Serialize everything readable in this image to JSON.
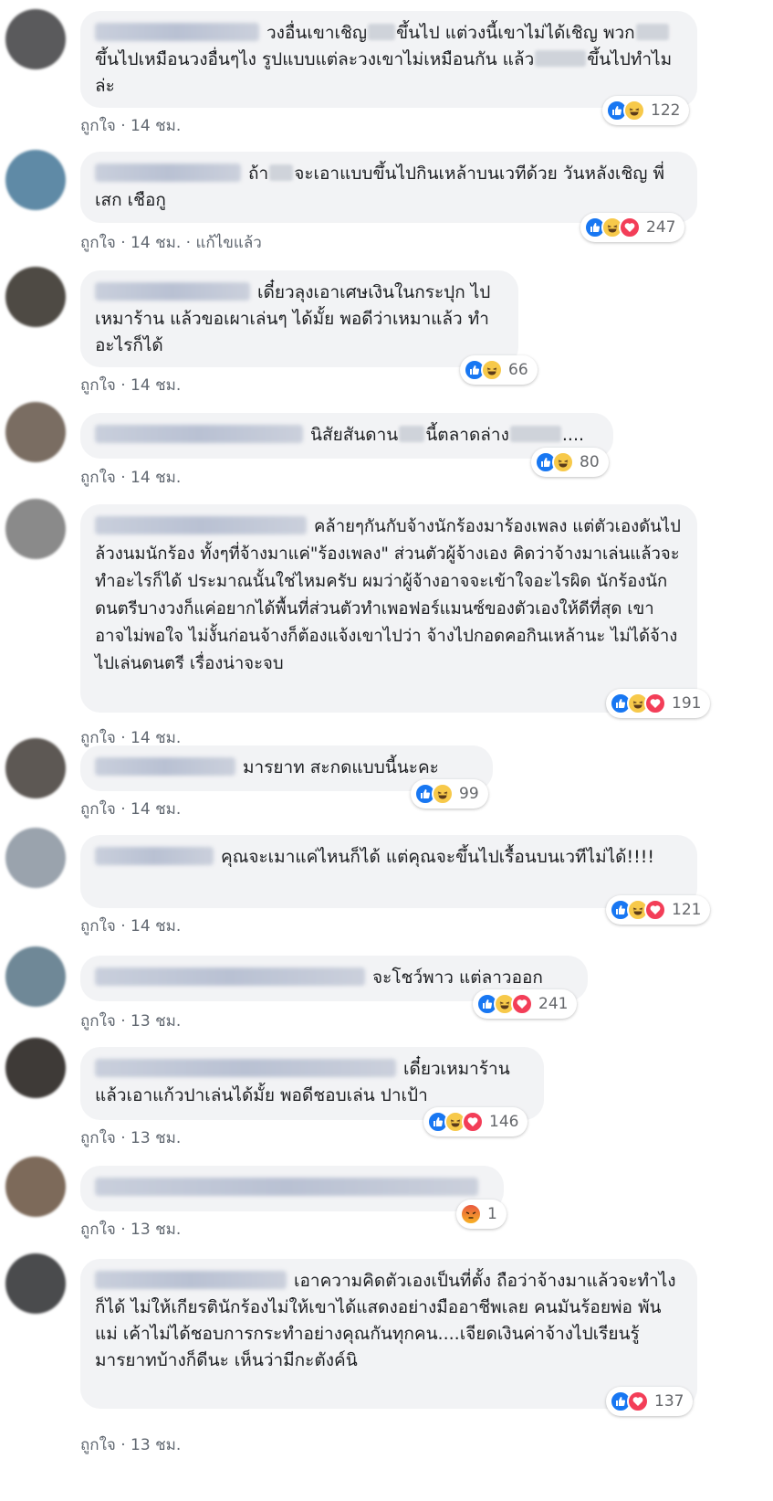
{
  "comments": [
    {
      "text": "วงอื่นเขาเชิญ▒ขึ้นไป แต่วงนี้เขาไม่ได้เชิญ พวก▒ขึ้นไปเหมือนวงอื่นๆไง รูปแบบแต่ละวงเขาไม่เหมือนกัน แล้ว▒ขึ้นไปทำไมล่ะ",
      "meta": "ถูกใจ · 14 ชม.",
      "reactions": [
        "like",
        "haha"
      ],
      "count": "122",
      "avatar": "#5a5a5c"
    },
    {
      "text": "ถ้า▒จะเอาแบบขึ้นไปกินเหล้าบนเวทีด้วย วันหลังเชิญ พี่เสก เชือกู",
      "meta": "ถูกใจ · 14 ชม. · แก้ไขแล้ว",
      "reactions": [
        "like",
        "haha",
        "love"
      ],
      "count": "247",
      "avatar": "#5f8aa6"
    },
    {
      "text": "เดี๋ยวลุงเอาเศษเงินในกระปุก ไปเหมาร้าน แล้วขอเผาเล่นๆ ได้มั้ย พอดีว่าเหมาแล้ว ทำอะไรก็ได้",
      "meta": "ถูกใจ · 14 ชม.",
      "reactions": [
        "like",
        "haha"
      ],
      "count": "66",
      "avatar": "#4e4a44"
    },
    {
      "text": "นิสัยสันดาน▒นี้ตลาดล่าง▒....",
      "meta": "ถูกใจ · 14 ชม.",
      "reactions": [
        "like",
        "haha"
      ],
      "count": "80",
      "avatar": "#7a6d62"
    },
    {
      "text": "คล้ายๆกันกับจ้างนักร้องมาร้องเพลง แต่ตัวเองดันไปล้วงนมนักร้อง ทั้งๆที่จ้างมาแค่\"ร้องเพลง\" ส่วนตัวผู้จ้างเอง คิดว่าจ้างมาเล่นแล้วจะทำอะไรก็ได้ ประมาณนั้นใช่ไหมครับ ผมว่าผู้จ้างอาจจะเข้าใจอะไรผิด นักร้องนักดนตรีบางวงก็แค่อยากได้พื้นที่ส่วนตัวทำเพอฟอร์แมนซ์ของตัวเองให้ดีที่สุด เขาอาจไม่พอใจ ไม่งั้นก่อนจ้างก็ต้องแจ้งเขาไปว่า จ้างไปกอดคอกินเหล้านะ ไม่ได้จ้างไปเล่นดนตรี เรื่องน่าจะจบ",
      "meta": "ถูกใจ · 14 ชม.",
      "reactions": [
        "like",
        "haha",
        "love"
      ],
      "count": "191",
      "avatar": "#8a8a8a"
    },
    {
      "text": "มารยาท สะกดแบบนี้นะคะ",
      "meta": "ถูกใจ · 14 ชม.",
      "reactions": [
        "like",
        "haha"
      ],
      "count": "99",
      "avatar": "#5d5854"
    },
    {
      "text": "คุณจะเมาแค่ไหนก็ได้ แต่คุณจะขึ้นไปเรื้อนบนเวทีไม่ได้!!!!",
      "meta": "ถูกใจ · 14 ชม.",
      "reactions": [
        "like",
        "haha",
        "love"
      ],
      "count": "121",
      "avatar": "#9aa3ad"
    },
    {
      "text": "จะโชว์พาว แต่ลาวออก",
      "meta": "ถูกใจ · 13 ชม.",
      "reactions": [
        "like",
        "haha",
        "love"
      ],
      "count": "241",
      "avatar": "#6f8897"
    },
    {
      "text": "เดี๋ยวเหมาร้าน แล้วเอาแก้วปาเล่นได้มั้ย พอดีชอบเล่น ปาเป้า",
      "meta": "ถูกใจ · 13 ชม.",
      "reactions": [
        "like",
        "haha",
        "love"
      ],
      "count": "146",
      "avatar": "#3e3a37"
    },
    {
      "text": "",
      "meta": "ถูกใจ · 13 ชม.",
      "reactions": [
        "angry"
      ],
      "count": "1",
      "avatar": "#7d6a5a"
    },
    {
      "text": "เอาความคิดตัวเองเป็นที่ตั้ง ถือว่าจ้างมาแล้วจะทำไงก็ได้ ไม่ให้เกียรตินักร้องไม่ให้เขาได้แสดงอย่างมืออาชีพเลย คนมันร้อยพ่อ พันแม่ เค้าไม่ได้ชอบการกระทำอย่างคุณกันทุกคน....เจียดเงินค่าจ้างไปเรียนรู้มารยาทบ้างก็ดีนะ เห็นว่ามีกะตังค์นิ",
      "meta": "ถูกใจ · 13 ชม.",
      "reactions": [
        "like",
        "love"
      ],
      "count": "137",
      "avatar": "#4a4b4d"
    }
  ]
}
